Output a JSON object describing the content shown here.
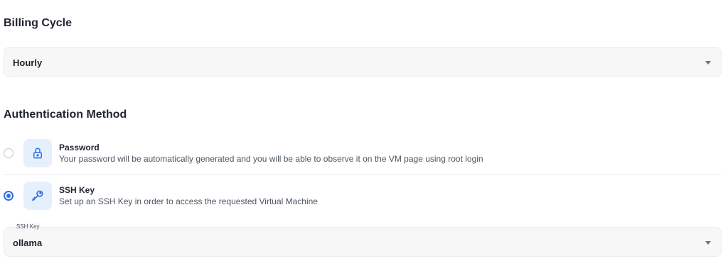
{
  "billing": {
    "title": "Billing Cycle",
    "selected": "Hourly"
  },
  "auth": {
    "title": "Authentication Method",
    "options": [
      {
        "title": "Password",
        "description": "Your password will be automatically generated and you will be able to observe it on the VM page using root login",
        "icon": "lock-icon",
        "selected": false
      },
      {
        "title": "SSH Key",
        "description": "Set up an SSH Key in order to access the requested Virtual Machine",
        "icon": "key-icon",
        "selected": true
      }
    ]
  },
  "ssh_key": {
    "label": "SSH Key",
    "selected": "ollama"
  },
  "colors": {
    "accent": "#2f6fe4",
    "icon_bg": "#e6f0fd",
    "field_bg": "#f7f7f8"
  }
}
